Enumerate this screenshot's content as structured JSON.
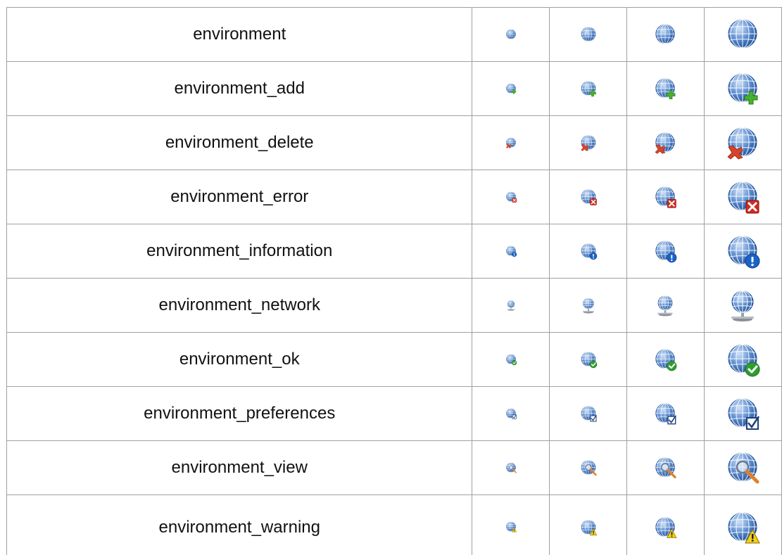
{
  "icon_sizes": [
    "16",
    "24",
    "32",
    "48"
  ],
  "colors": {
    "globe_light": "#cfe2f8",
    "globe_mid": "#5f8fd0",
    "globe_dark": "#1d4f9a",
    "add": "#46b22e",
    "delete": "#d8442a",
    "error": "#d42a1e",
    "info": "#1a63c6",
    "ok": "#2f9e2f",
    "warning": "#f2cf1a",
    "border": "#a0a0a0"
  },
  "rows": [
    {
      "name": "environment",
      "overlay": "none",
      "icon": "globe-icon"
    },
    {
      "name": "environment_add",
      "overlay": "add",
      "icon": "globe-add-icon"
    },
    {
      "name": "environment_delete",
      "overlay": "delete",
      "icon": "globe-delete-icon"
    },
    {
      "name": "environment_error",
      "overlay": "error",
      "icon": "globe-error-icon"
    },
    {
      "name": "environment_information",
      "overlay": "info",
      "icon": "globe-information-icon"
    },
    {
      "name": "environment_network",
      "overlay": "network",
      "icon": "globe-network-icon"
    },
    {
      "name": "environment_ok",
      "overlay": "ok",
      "icon": "globe-ok-icon"
    },
    {
      "name": "environment_preferences",
      "overlay": "prefs",
      "icon": "globe-preferences-icon"
    },
    {
      "name": "environment_view",
      "overlay": "view",
      "icon": "globe-view-icon"
    },
    {
      "name": "environment_warning",
      "overlay": "warning",
      "icon": "globe-warning-icon"
    }
  ]
}
